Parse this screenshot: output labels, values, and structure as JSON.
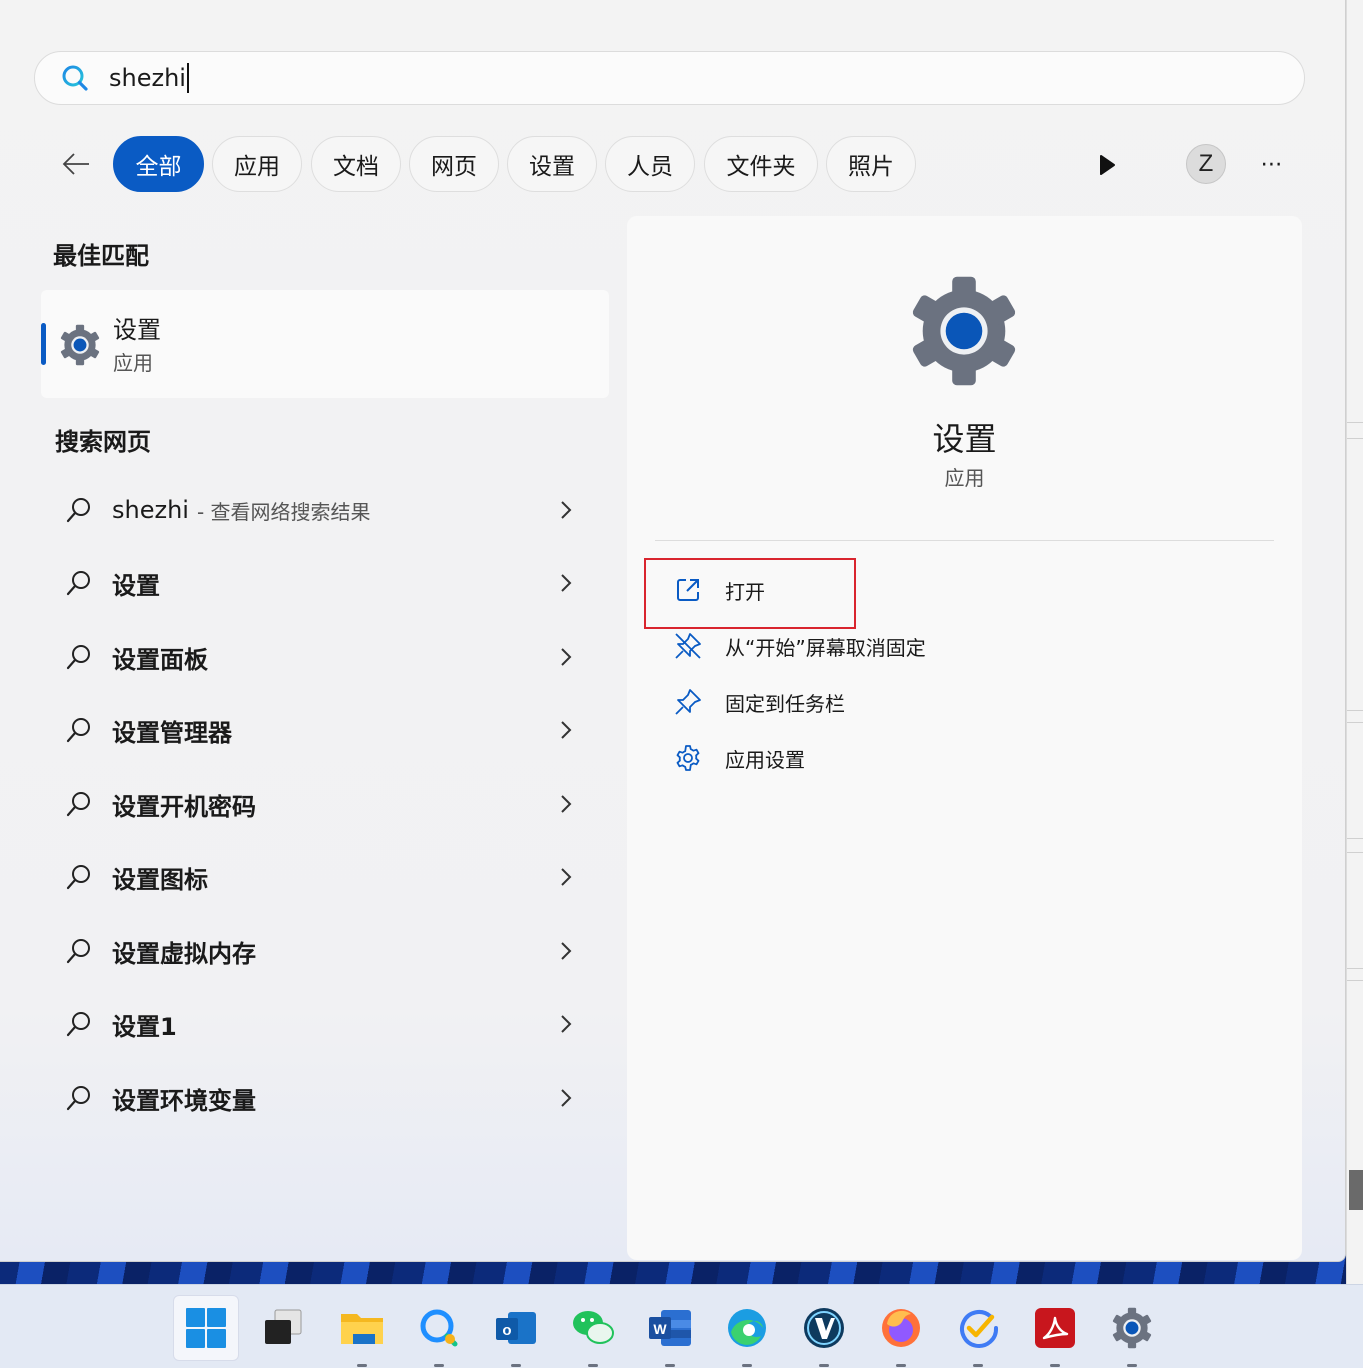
{
  "search": {
    "value": "shezhi"
  },
  "filters": {
    "tabs": [
      "全部",
      "应用",
      "文档",
      "网页",
      "设置",
      "人员",
      "文件夹",
      "照片"
    ],
    "active_index": 0,
    "avatar_letter": "Z",
    "more_label": "⋯"
  },
  "best_match": {
    "heading": "最佳匹配",
    "title": "设置",
    "subtitle": "应用"
  },
  "web_search": {
    "heading": "搜索网页",
    "items": [
      {
        "label": "shezhi",
        "hint": "- 查看网络搜索结果"
      },
      {
        "label": "设置"
      },
      {
        "label": "设置面板"
      },
      {
        "label": "设置管理器"
      },
      {
        "label": "设置开机密码"
      },
      {
        "label": "设置图标"
      },
      {
        "label": "设置虚拟内存"
      },
      {
        "label": "设置1"
      },
      {
        "label": "设置环境变量"
      }
    ]
  },
  "detail": {
    "title": "设置",
    "subtitle": "应用",
    "actions": [
      {
        "label": "打开",
        "icon": "open-external-icon"
      },
      {
        "label": "从“开始”屏幕取消固定",
        "icon": "unpin-icon"
      },
      {
        "label": "固定到任务栏",
        "icon": "pin-icon"
      },
      {
        "label": "应用设置",
        "icon": "gear-icon"
      }
    ]
  },
  "taskbar": {
    "apps": [
      "start-icon",
      "task-view-icon",
      "file-explorer-icon",
      "chat-icon",
      "outlook-icon",
      "wechat-icon",
      "word-icon",
      "edge-icon",
      "vim-icon",
      "firefox-icon",
      "todo-icon",
      "acrobat-icon",
      "settings-icon"
    ]
  },
  "colors": {
    "accent": "#0a5bc4",
    "highlight_box": "#d9252e"
  }
}
